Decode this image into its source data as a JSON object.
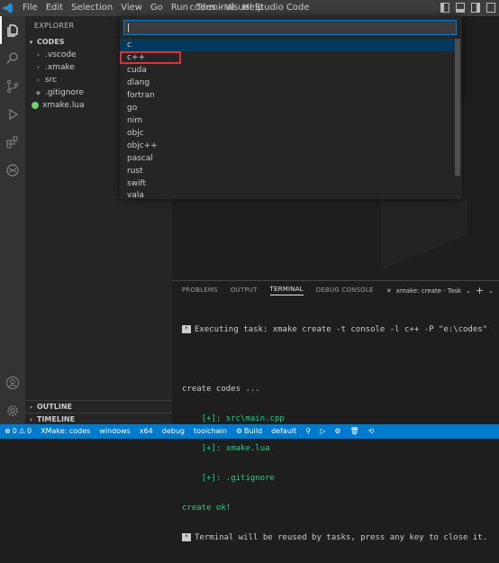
{
  "titlebar": {
    "menu": [
      "File",
      "Edit",
      "Selection",
      "View",
      "Go",
      "Run",
      "Terminal",
      "Help"
    ],
    "title": "codes - Visual Studio Code"
  },
  "sidebar": {
    "header": "EXPLORER",
    "root": "CODES",
    "items": [
      {
        "label": ".vscode",
        "type": "folder"
      },
      {
        "label": ".xmake",
        "type": "folder"
      },
      {
        "label": "src",
        "type": "folder"
      },
      {
        "label": ".gitignore",
        "type": "file"
      },
      {
        "label": "xmake.lua",
        "type": "file"
      }
    ],
    "outline": "OUTLINE",
    "timeline": "TIMELINE"
  },
  "picker": {
    "input_value": "",
    "options": [
      "c",
      "c++",
      "cuda",
      "dlang",
      "fortran",
      "go",
      "nim",
      "objc",
      "objc++",
      "pascal",
      "rust",
      "swift",
      "vala"
    ],
    "selected_index": 0,
    "highlighted_index": 1
  },
  "panel": {
    "tabs": [
      "PROBLEMS",
      "OUTPUT",
      "TERMINAL",
      "DEBUG CONSOLE"
    ],
    "active_tab": "TERMINAL",
    "task_label": "xmake: create - Task",
    "terminal": {
      "task_line": "Executing task: xmake create -t console -l c++ -P \"e:\\codes\"",
      "create_line": "create codes ...",
      "files": [
        "[+]: src\\main.cpp",
        "[+]: xmake.lua",
        "[+]: .gitignore"
      ],
      "ok_line": "create ok!",
      "reuse_line": "Terminal will be reused by tasks, press any key to close it."
    }
  },
  "statusbar": {
    "errors": "0",
    "warnings": "0",
    "xmake": "XMake: codes",
    "platform": "windows",
    "arch": "x64",
    "mode": "debug",
    "toolchain": "toolchain",
    "build": "Build",
    "target": "default"
  },
  "colors": {
    "accent": "#007acc",
    "highlight_border": "#d6343c",
    "selection": "#04395e",
    "green": "#23d18b"
  }
}
